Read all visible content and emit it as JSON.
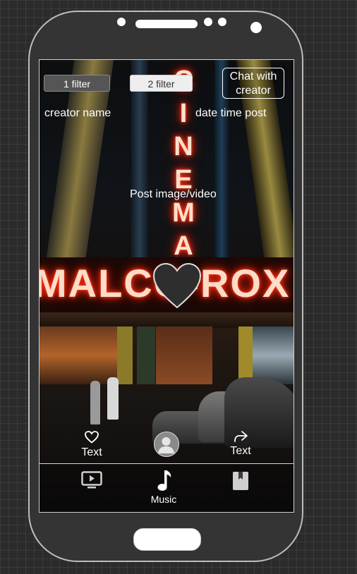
{
  "header": {
    "filter_1": "1 filter",
    "filter_2": "2 filter",
    "chat_line1": "Chat with",
    "chat_line2": "creator"
  },
  "post": {
    "creator_name": "creator name",
    "date_time": "date time post",
    "media_label": "Post image/video",
    "sign_vertical": [
      "C",
      "I",
      "N",
      "E",
      "M",
      "A"
    ],
    "sign_horizontal": "MALCO-ROX"
  },
  "actions": {
    "like_label": "Text",
    "share_label": "Text"
  },
  "tabbar": {
    "tabs": [
      {
        "icon": "tv-icon",
        "label": ""
      },
      {
        "icon": "music-note-icon",
        "label": "Music"
      },
      {
        "icon": "book-icon",
        "label": ""
      }
    ]
  },
  "colors": {
    "background": "#2b2b2b",
    "phone_body": "#343434",
    "neon": "#ff2a10"
  }
}
